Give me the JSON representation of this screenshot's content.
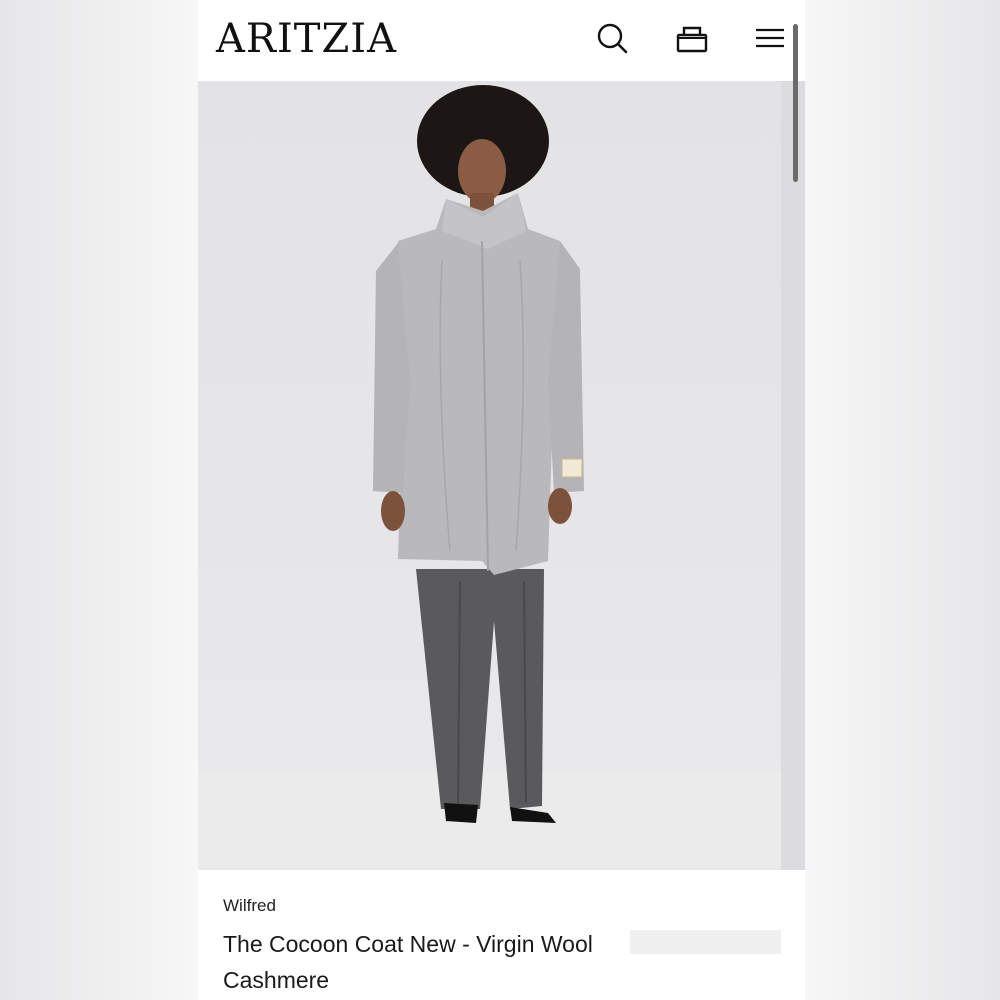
{
  "header": {
    "logo": "ARITZIA",
    "icons": [
      "search-icon",
      "bag-icon",
      "menu-icon"
    ]
  },
  "product": {
    "brand": "Wilfred",
    "name": "The Cocoon Coat New - Virgin Wool Cashmere",
    "image_alt": "Model wearing a light grey high-collar wool coat with grey wide-leg trousers"
  },
  "colors": {
    "coat": "#b9b9bb",
    "trousers": "#5a5a5c",
    "background": "#e5e5e7"
  }
}
